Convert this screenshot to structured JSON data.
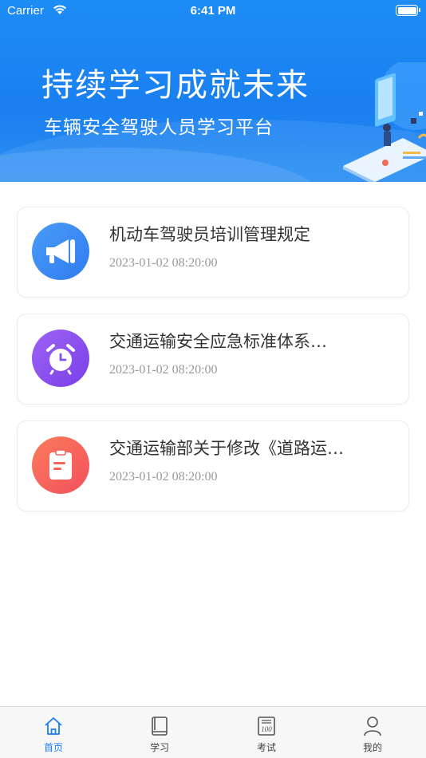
{
  "status_bar": {
    "carrier": "Carrier",
    "time": "6:41 PM"
  },
  "banner": {
    "title": "持续学习成就未来",
    "subtitle": "车辆安全驾驶人员学习平台"
  },
  "news": [
    {
      "icon": "megaphone-icon",
      "title": "机动车驾驶员培训管理规定",
      "time": "2023-01-02 08:20:00",
      "color": "#3d8ff5"
    },
    {
      "icon": "alarm-clock-icon",
      "title": "交通运输安全应急标准体系…",
      "time": "2023-01-02 08:20:00",
      "color": "#8a4ff0"
    },
    {
      "icon": "clipboard-icon",
      "title": "交通运输部关于修改《道路运…",
      "time": "2023-01-02 08:20:00",
      "color": "#f4645a"
    }
  ],
  "tabbar": {
    "items": [
      {
        "label": "首页",
        "icon": "home-icon",
        "active": true
      },
      {
        "label": "学习",
        "icon": "book-icon",
        "active": false
      },
      {
        "label": "考试",
        "icon": "exam-icon",
        "active": false
      },
      {
        "label": "我的",
        "icon": "user-icon",
        "active": false
      }
    ],
    "active_color": "#1a7ff0"
  }
}
